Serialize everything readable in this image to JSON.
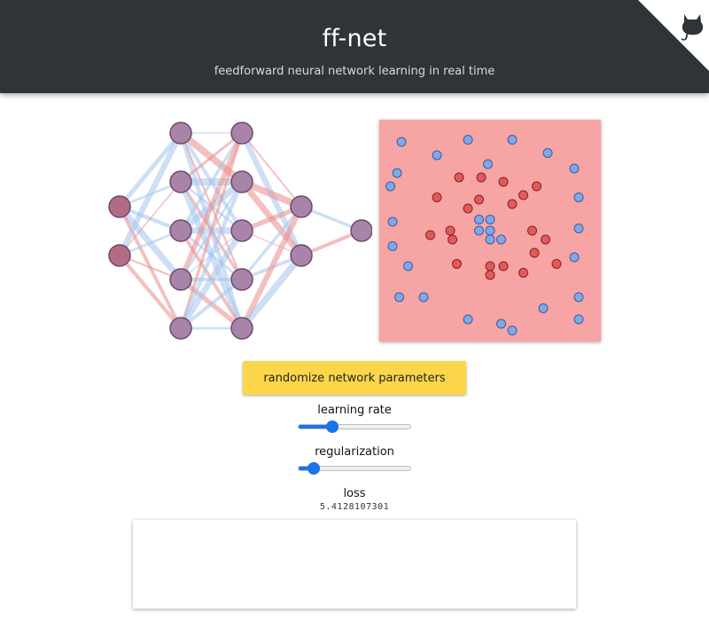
{
  "header": {
    "title": "ff-net",
    "subtitle": "feedforward neural network learning in real time",
    "background": "#2f3438"
  },
  "corner": {
    "icon": "github-octocat-icon"
  },
  "network": {
    "layers": [
      2,
      5,
      5,
      2,
      1
    ],
    "colors": {
      "positive": "#ea8c8c",
      "negative": "#a6c4ec",
      "input_node": "#b36b85",
      "hidden_node": "#a884a8",
      "node_stroke": "#6e4a6e"
    }
  },
  "scatter": {
    "background": "#f7a4a4",
    "class_colors": {
      "blue": "#7ea8e8",
      "red": "#e25a5a"
    },
    "points": [
      [
        0.1,
        0.1,
        "blue"
      ],
      [
        0.4,
        0.09,
        "blue"
      ],
      [
        0.6,
        0.09,
        "blue"
      ],
      [
        0.26,
        0.16,
        "blue"
      ],
      [
        0.76,
        0.15,
        "blue"
      ],
      [
        0.88,
        0.22,
        "blue"
      ],
      [
        0.08,
        0.24,
        "blue"
      ],
      [
        0.05,
        0.3,
        "blue"
      ],
      [
        0.9,
        0.35,
        "blue"
      ],
      [
        0.06,
        0.46,
        "blue"
      ],
      [
        0.9,
        0.49,
        "blue"
      ],
      [
        0.06,
        0.57,
        "blue"
      ],
      [
        0.88,
        0.62,
        "blue"
      ],
      [
        0.13,
        0.66,
        "blue"
      ],
      [
        0.09,
        0.8,
        "blue"
      ],
      [
        0.2,
        0.8,
        "blue"
      ],
      [
        0.74,
        0.85,
        "blue"
      ],
      [
        0.9,
        0.8,
        "blue"
      ],
      [
        0.4,
        0.9,
        "blue"
      ],
      [
        0.55,
        0.92,
        "blue"
      ],
      [
        0.6,
        0.95,
        "blue"
      ],
      [
        0.9,
        0.9,
        "blue"
      ],
      [
        0.45,
        0.45,
        "blue"
      ],
      [
        0.5,
        0.45,
        "blue"
      ],
      [
        0.45,
        0.5,
        "blue"
      ],
      [
        0.5,
        0.5,
        "blue"
      ],
      [
        0.55,
        0.54,
        "blue"
      ],
      [
        0.5,
        0.54,
        "blue"
      ],
      [
        0.49,
        0.2,
        "blue"
      ],
      [
        0.36,
        0.26,
        "red"
      ],
      [
        0.46,
        0.26,
        "red"
      ],
      [
        0.56,
        0.28,
        "red"
      ],
      [
        0.71,
        0.3,
        "red"
      ],
      [
        0.65,
        0.34,
        "red"
      ],
      [
        0.26,
        0.35,
        "red"
      ],
      [
        0.45,
        0.36,
        "red"
      ],
      [
        0.4,
        0.4,
        "red"
      ],
      [
        0.6,
        0.38,
        "red"
      ],
      [
        0.32,
        0.5,
        "red"
      ],
      [
        0.23,
        0.52,
        "red"
      ],
      [
        0.33,
        0.54,
        "red"
      ],
      [
        0.69,
        0.5,
        "red"
      ],
      [
        0.75,
        0.54,
        "red"
      ],
      [
        0.7,
        0.6,
        "red"
      ],
      [
        0.35,
        0.65,
        "red"
      ],
      [
        0.5,
        0.66,
        "red"
      ],
      [
        0.56,
        0.66,
        "red"
      ],
      [
        0.8,
        0.65,
        "red"
      ],
      [
        0.65,
        0.69,
        "red"
      ],
      [
        0.5,
        0.7,
        "red"
      ]
    ]
  },
  "controls": {
    "randomize_label": "randomize network parameters",
    "learning_rate_label": "learning rate",
    "learning_rate_fraction": 0.28,
    "regularization_label": "regularization",
    "regularization_fraction": 0.1,
    "loss_label": "loss",
    "loss_value": "5.4128107301",
    "accent": "#1a73e8",
    "button_color": "#fcd64a"
  }
}
